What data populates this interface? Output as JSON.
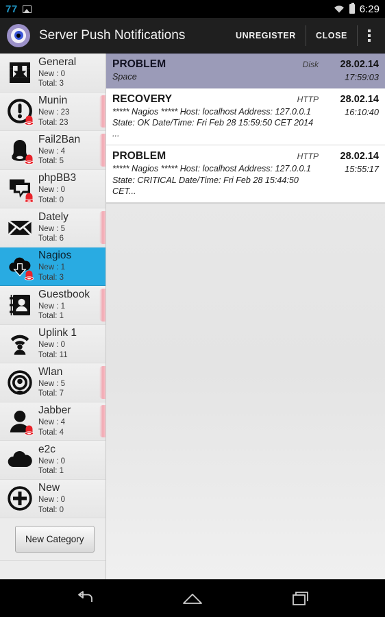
{
  "statusbar": {
    "notification_count": "77",
    "screenshot_icon": "image-icon",
    "wifi_icon": "wifi-icon",
    "battery_icon": "battery-icon",
    "time": "6:29"
  },
  "actionbar": {
    "app_icon": "eye-icon",
    "title": "Server Push Notifications",
    "unregister_label": "UNREGISTER",
    "close_label": "CLOSE",
    "overflow_icon": "overflow-menu-icon"
  },
  "sidebar": {
    "new_category_label": "New Category",
    "labels": {
      "new": "New :",
      "total": "Total:"
    },
    "selected_accent": "#29abe2",
    "unread_strip_color": "#f3a8b2",
    "items": [
      {
        "name": "General",
        "icon": "inbox-download-icon",
        "new": "New :  0",
        "total": "Total: 3",
        "selected": false,
        "unread": false,
        "badge": false
      },
      {
        "name": "Munin",
        "icon": "exclamation-circle-icon",
        "new": "New :  23",
        "total": "Total: 23",
        "selected": false,
        "unread": true,
        "badge": true
      },
      {
        "name": "Fail2Ban",
        "icon": "bell-icon",
        "new": "New : 4",
        "total": "Total: 5",
        "selected": false,
        "unread": true,
        "badge": true
      },
      {
        "name": "phpBB3",
        "icon": "chat-bubbles-icon",
        "new": "New :  0",
        "total": "Total: 0",
        "selected": false,
        "unread": false,
        "badge": true
      },
      {
        "name": "Dately",
        "icon": "envelope-icon",
        "new": "New :  5",
        "total": "Total: 6",
        "selected": false,
        "unread": true,
        "badge": false
      },
      {
        "name": "Nagios",
        "icon": "cloud-download-icon",
        "new": "New : 1",
        "total": "Total: 3",
        "selected": true,
        "unread": false,
        "badge": true
      },
      {
        "name": "Guestbook",
        "icon": "address-book-icon",
        "new": "New :  1",
        "total": "Total: 1",
        "selected": false,
        "unread": true,
        "badge": false
      },
      {
        "name": "Uplink 1",
        "icon": "wifi-person-icon",
        "new": "New : 0",
        "total": "Total: 11",
        "selected": false,
        "unread": false,
        "badge": false
      },
      {
        "name": "Wlan",
        "icon": "broadcast-person-icon",
        "new": "New : 5",
        "total": "Total: 7",
        "selected": false,
        "unread": true,
        "badge": false
      },
      {
        "name": "Jabber",
        "icon": "person-icon",
        "new": "New :  4",
        "total": "Total: 4",
        "selected": false,
        "unread": true,
        "badge": true
      },
      {
        "name": "e2c",
        "icon": "cloud-icon",
        "new": "New : 0",
        "total": "Total: 1",
        "selected": false,
        "unread": false,
        "badge": false
      },
      {
        "name": "New",
        "icon": "plus-circle-icon",
        "new": "New :  0",
        "total": "Total: 0",
        "selected": false,
        "unread": false,
        "badge": false
      }
    ]
  },
  "notifications": {
    "selected_background": "#9b9bb8",
    "items": [
      {
        "title": "PROBLEM",
        "tag": "Disk",
        "date": "28.02.14",
        "time": "17:59:03",
        "body": "Space",
        "selected": true
      },
      {
        "title": "RECOVERY",
        "tag": "HTTP",
        "date": "28.02.14",
        "time": "16:10:40",
        "body": "***** Nagios *****  Host: localhost Address: 127.0.0.1 State: OK  Date/Time: Fri Feb 28 15:59:50 CET 2014 ...",
        "selected": false
      },
      {
        "title": "PROBLEM",
        "tag": "HTTP",
        "date": "28.02.14",
        "time": "15:55:17",
        "body": "***** Nagios *****  Host: localhost Address: 127.0.0.1 State: CRITICAL  Date/Time: Fri Feb 28 15:44:50 CET...",
        "selected": false
      }
    ]
  },
  "navbar": {
    "back_icon": "back-arrow-icon",
    "home_icon": "home-icon",
    "recents_icon": "recents-icon"
  }
}
